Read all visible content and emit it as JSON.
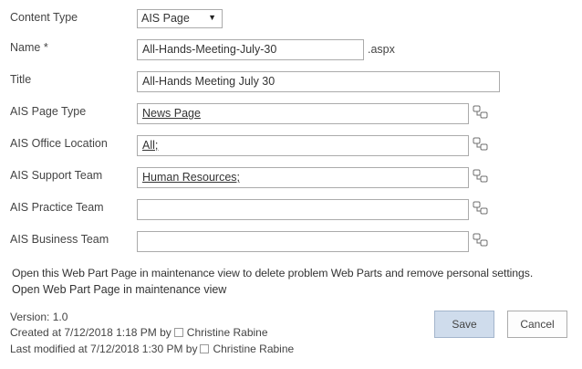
{
  "form": {
    "content_type": {
      "label": "Content Type",
      "value": "AIS Page"
    },
    "name": {
      "label": "Name",
      "required_mark": "*",
      "value": "All-Hands-Meeting-July-30",
      "suffix": ".aspx"
    },
    "title": {
      "label": "Title",
      "value": "All-Hands Meeting July 30"
    },
    "page_type": {
      "label": "AIS Page Type",
      "value": "News Page"
    },
    "office_location": {
      "label": "AIS Office Location",
      "value": "All;"
    },
    "support_team": {
      "label": "AIS Support Team",
      "value": "Human Resources;"
    },
    "practice_team": {
      "label": "AIS Practice Team",
      "value": ""
    },
    "business_team": {
      "label": "AIS Business Team",
      "value": ""
    }
  },
  "maintenance": {
    "description": "Open this Web Part Page in maintenance view to delete problem Web Parts and remove personal settings.",
    "link": "Open Web Part Page in maintenance view"
  },
  "meta": {
    "version": "Version: 1.0",
    "created_prefix": "Created at 7/12/2018 1:18 PM  by",
    "created_by": "Christine Rabine",
    "modified_prefix": "Last modified at 7/12/2018 1:30 PM  by",
    "modified_by": "Christine Rabine"
  },
  "buttons": {
    "save": "Save",
    "cancel": "Cancel"
  },
  "icons": {
    "picker": "taxonomy-picker-icon",
    "dropdown": "dropdown-arrow-icon"
  },
  "colors": {
    "primary_button": "#cfdcec",
    "border": "#ababab"
  }
}
